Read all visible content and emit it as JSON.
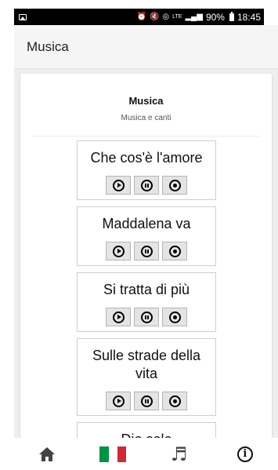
{
  "status_bar": {
    "battery": "90%",
    "time": "18:45",
    "network": "LTE"
  },
  "appbar": {
    "title": "Musica"
  },
  "card": {
    "title": "Musica",
    "subtitle": "Musica e canti"
  },
  "songs": [
    {
      "title": "Che cos'è l'amore"
    },
    {
      "title": "Maddalena va"
    },
    {
      "title": "Si tratta di più"
    },
    {
      "title": "Sulle strade della vita"
    },
    {
      "title": "Dio solo"
    }
  ],
  "controls": {
    "play_icon": "play-circle-icon",
    "pause_icon": "pause-circle-icon",
    "stop_icon": "stop-circle-icon"
  },
  "bottom_nav": {
    "items": [
      {
        "icon": "home-icon"
      },
      {
        "icon": "italy-flag-icon"
      },
      {
        "icon": "music-notes-icon"
      },
      {
        "icon": "info-icon"
      }
    ]
  },
  "colors": {
    "flag_green": "#009246",
    "flag_white": "#ffffff",
    "flag_red": "#ce2b37",
    "appbar_bg": "#f5f5f5",
    "content_bg": "#eeeeee"
  }
}
